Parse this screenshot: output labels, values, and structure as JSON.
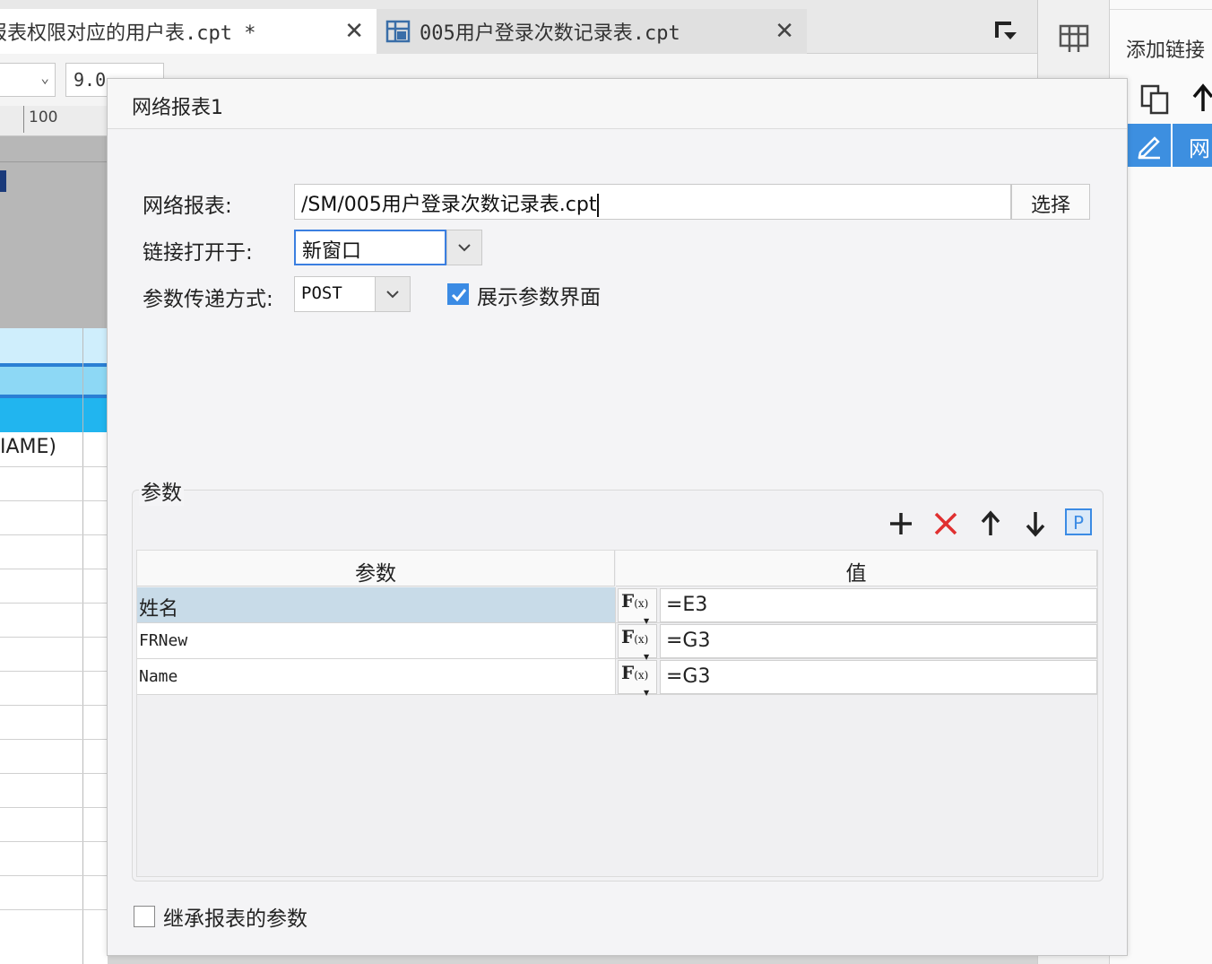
{
  "tabs": [
    {
      "label": "报表权限对应的用户表.cpt *",
      "close": "✕"
    },
    {
      "label": "005用户登录次数记录表.cpt",
      "close": "✕"
    }
  ],
  "toolbar": {
    "font_size_value": "9.0"
  },
  "ruler": {
    "mark": "100"
  },
  "sheet": {
    "cell_text": "IAME)"
  },
  "right_panel": {
    "title": "添加链接",
    "row_text": "网"
  },
  "dialog": {
    "title": "网络报表1",
    "report_label": "网络报表:",
    "report_path": "/SM/005用户登录次数记录表.cpt",
    "select_button": "选择",
    "open_in_label": "链接打开于:",
    "open_in_value": "新窗口",
    "param_method_label": "参数传递方式:",
    "param_method_value": "POST",
    "show_params_label": "展示参数界面",
    "show_params_checked": true,
    "params_group_title": "参数",
    "table_headers": {
      "param": "参数",
      "value": "值"
    },
    "rows": [
      {
        "name": "姓名",
        "fx": "F",
        "fx_sub": "(x)",
        "value": "=E3",
        "selected": true
      },
      {
        "name": "FRNew",
        "fx": "F",
        "fx_sub": "(x)",
        "value": "=G3",
        "selected": false
      },
      {
        "name": "Name",
        "fx": "F",
        "fx_sub": "(x)",
        "value": "=G3",
        "selected": false
      }
    ],
    "inherit_label": "继承报表的参数",
    "inherit_checked": false,
    "param_tools": [
      "plus-icon",
      "delete-icon",
      "arrow-up-icon",
      "arrow-down-icon",
      "p-icon"
    ],
    "param_tool_p": "P"
  },
  "colors": {
    "accent": "#3b8be4",
    "selected_row": "#c8dbe8",
    "delete": "#e03030"
  }
}
